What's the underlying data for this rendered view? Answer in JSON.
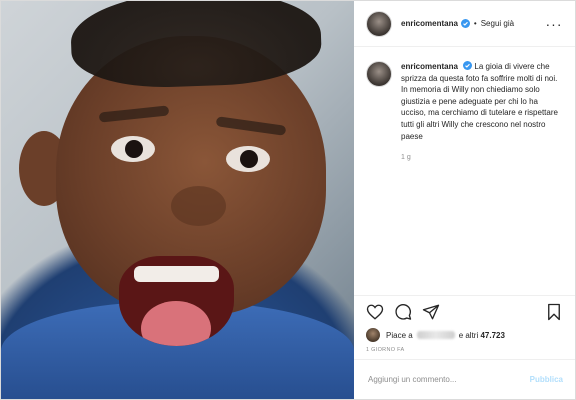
{
  "post": {
    "username": "enricomentana",
    "follow_label": "Segui già",
    "caption": "La gioia di vivere che sprizza da questa foto fa soffrire molti di noi. In memoria di Willy non chiediamo solo giustizia e pene adeguate per chi lo ha ucciso, ma cerchiamo di tutelare e rispettare tutti gli altri Willy che crescono nel nostro paese",
    "caption_time": "1 g",
    "liked_by_prefix": "Piace a",
    "liked_by_suffix": "e altri",
    "likes_count": "47.723",
    "date": "1 GIORNO FA",
    "comment_placeholder": "Aggiungi un commento...",
    "publish_label": "Pubblica",
    "separator": "•",
    "icons": [
      "verified-icon",
      "more-icon",
      "heart-icon",
      "comment-icon",
      "share-icon",
      "bookmark-icon"
    ],
    "colors": {
      "verified": "#3897f0",
      "publish": "#b2dffc",
      "muted": "#8e8e8e",
      "text": "#262626"
    }
  }
}
